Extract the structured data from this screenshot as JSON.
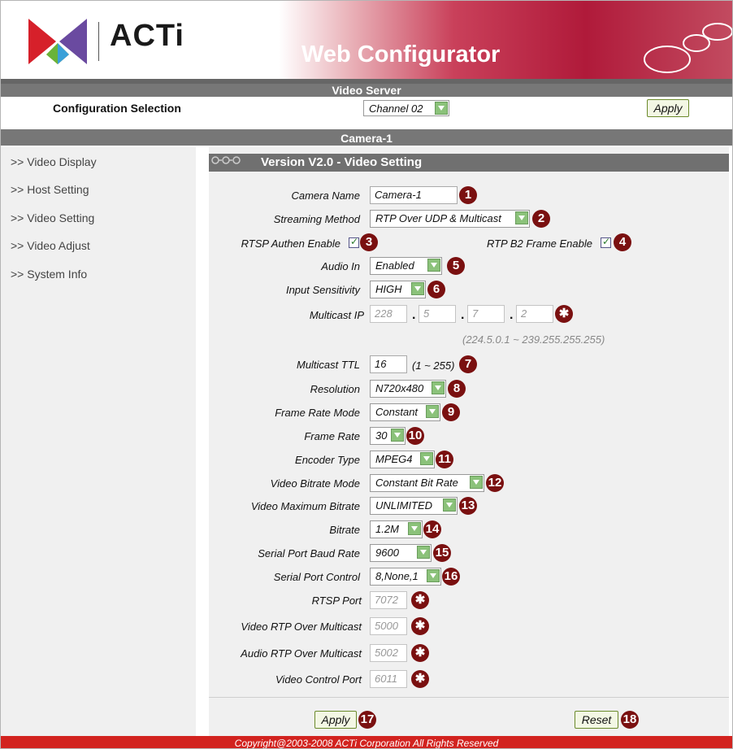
{
  "header": {
    "brand": "ACTi",
    "app_title": "Web Configurator"
  },
  "server_bar": {
    "title": "Video Server"
  },
  "config": {
    "label": "Configuration Selection",
    "channel_value": "Channel 02",
    "apply_label": "Apply"
  },
  "camera_bar": {
    "title": "Camera-1"
  },
  "sidebar": {
    "items": [
      {
        "label": ">> Video Display"
      },
      {
        "label": ">> Host Setting"
      },
      {
        "label": ">> Video Setting"
      },
      {
        "label": ">> Video Adjust"
      },
      {
        "label": ">> System Info"
      }
    ]
  },
  "panel": {
    "title": "Version V2.0 - Video Setting",
    "fields": {
      "camera_name": {
        "label": "Camera Name",
        "value": "Camera-1",
        "badge": "1"
      },
      "streaming_method": {
        "label": "Streaming Method",
        "value": "RTP Over UDP & Multicast",
        "badge": "2"
      },
      "rtsp_authen": {
        "label": "RTSP Authen Enable",
        "checked": true,
        "badge": "3"
      },
      "rtp_b2": {
        "label": "RTP B2 Frame Enable",
        "checked": true,
        "badge": "4"
      },
      "audio_in": {
        "label": "Audio In",
        "value": "Enabled",
        "badge": "5"
      },
      "input_sensitivity": {
        "label": "Input Sensitivity",
        "value": "HIGH",
        "badge": "6"
      },
      "multicast_ip": {
        "label": "Multicast IP",
        "octets": [
          "228",
          "5",
          "7",
          "2"
        ],
        "separator": ".",
        "badge": "✱",
        "range": "(224.5.0.1 ~ 239.255.255.255)"
      },
      "multicast_ttl": {
        "label": "Multicast TTL",
        "value": "16",
        "hint": "(1 ~ 255)",
        "badge": "7"
      },
      "resolution": {
        "label": "Resolution",
        "value": "N720x480",
        "badge": "8"
      },
      "frame_rate_mode": {
        "label": "Frame Rate Mode",
        "value": "Constant",
        "badge": "9"
      },
      "frame_rate": {
        "label": "Frame Rate",
        "value": "30",
        "badge": "10"
      },
      "encoder_type": {
        "label": "Encoder Type",
        "value": "MPEG4",
        "badge": "11"
      },
      "video_bitrate_mode": {
        "label": "Video Bitrate Mode",
        "value": "Constant Bit Rate",
        "badge": "12"
      },
      "video_max_bitrate": {
        "label": "Video Maximum Bitrate",
        "value": "UNLIMITED",
        "badge": "13"
      },
      "bitrate": {
        "label": "Bitrate",
        "value": "1.2M",
        "badge": "14"
      },
      "serial_baud": {
        "label": "Serial Port Baud Rate",
        "value": "9600",
        "badge": "15"
      },
      "serial_control": {
        "label": "Serial Port Control",
        "value": "8,None,1",
        "badge": "16"
      },
      "rtsp_port": {
        "label": "RTSP Port",
        "value": "7072",
        "badge": "✱"
      },
      "video_rtp_multicast": {
        "label": "Video RTP Over Multicast",
        "value": "5000",
        "badge": "✱"
      },
      "audio_rtp_multicast": {
        "label": "Audio RTP Over Multicast",
        "value": "5002",
        "badge": "✱"
      },
      "video_control_port": {
        "label": "Video Control Port",
        "value": "6011",
        "badge": "✱"
      }
    },
    "apply_label": "Apply",
    "apply_badge": "17",
    "reset_label": "Reset",
    "reset_badge": "18"
  },
  "copyright": "Copyright@2003-2008 ACTi Corporation All Rights Reserved",
  "colors": {
    "brand_red": "#b01a3a",
    "badge": "#7a1010",
    "bar_gray": "#777777",
    "dropdown_green": "#8bc27a"
  }
}
